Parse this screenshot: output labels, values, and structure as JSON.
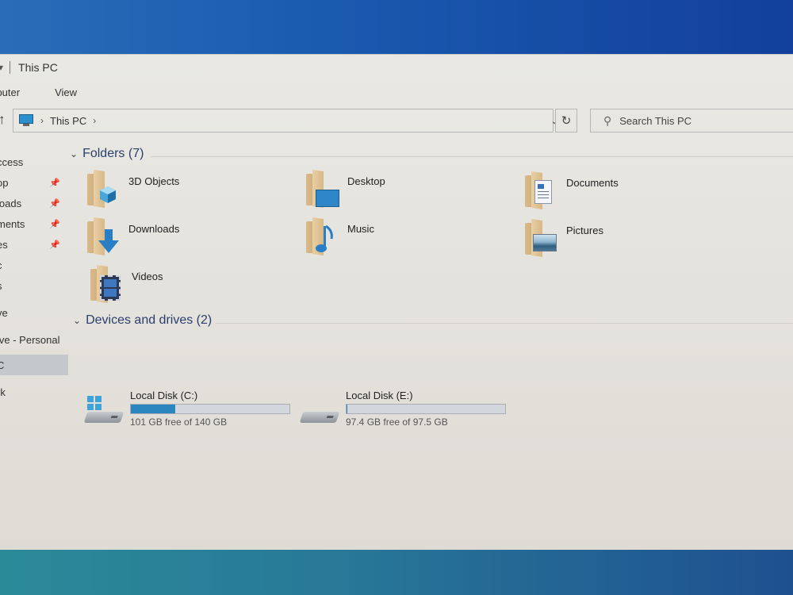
{
  "window": {
    "title": "This PC",
    "ribbon_tabs": [
      {
        "label": "Computer"
      },
      {
        "label": "View"
      }
    ]
  },
  "navigation": {
    "breadcrumb": [
      "This PC"
    ],
    "search_placeholder": "Search This PC"
  },
  "sidebar": {
    "items": [
      {
        "label": "Quick access",
        "pinned": false,
        "selected": false
      },
      {
        "label": "Desktop",
        "pinned": true,
        "selected": false
      },
      {
        "label": "Downloads",
        "pinned": true,
        "selected": false
      },
      {
        "label": "Documents",
        "pinned": true,
        "selected": false
      },
      {
        "label": "Pictures",
        "pinned": true,
        "selected": false
      },
      {
        "label": "Music",
        "pinned": false,
        "selected": false
      },
      {
        "label": "Videos",
        "pinned": false,
        "selected": false
      },
      {
        "label": "OneDrive",
        "pinned": false,
        "selected": false
      },
      {
        "label": "OneDrive - Personal",
        "pinned": false,
        "selected": false
      },
      {
        "label": "This PC",
        "pinned": false,
        "selected": true
      },
      {
        "label": "Network",
        "pinned": false,
        "selected": false
      }
    ],
    "visible_text": [
      "ccess",
      "op",
      "loads",
      "ments",
      "es",
      "c",
      "s",
      "ve",
      "ive - Personal",
      "C",
      "rk"
    ]
  },
  "folders_group": {
    "title": "Folders (7)",
    "items": [
      {
        "name": "3D Objects",
        "icon": "cube-icon"
      },
      {
        "name": "Desktop",
        "icon": "desktop-icon"
      },
      {
        "name": "Documents",
        "icon": "document-icon"
      },
      {
        "name": "Downloads",
        "icon": "download-arrow-icon"
      },
      {
        "name": "Music",
        "icon": "music-note-icon"
      },
      {
        "name": "Pictures",
        "icon": "picture-icon"
      },
      {
        "name": "Videos",
        "icon": "film-icon"
      }
    ]
  },
  "drives_group": {
    "title": "Devices and drives (2)",
    "items": [
      {
        "name": "Local Disk (C:)",
        "free_text": "101 GB free of 140 GB",
        "used_fraction": 0.279,
        "system_drive": true
      },
      {
        "name": "Local Disk (E:)",
        "free_text": "97.4 GB free of 97.5 GB",
        "used_fraction": 0.001,
        "system_drive": false
      }
    ]
  },
  "colors": {
    "accent": "#2b86c0",
    "group_header": "#2b3e6e",
    "selection": "#c4c7cc"
  }
}
